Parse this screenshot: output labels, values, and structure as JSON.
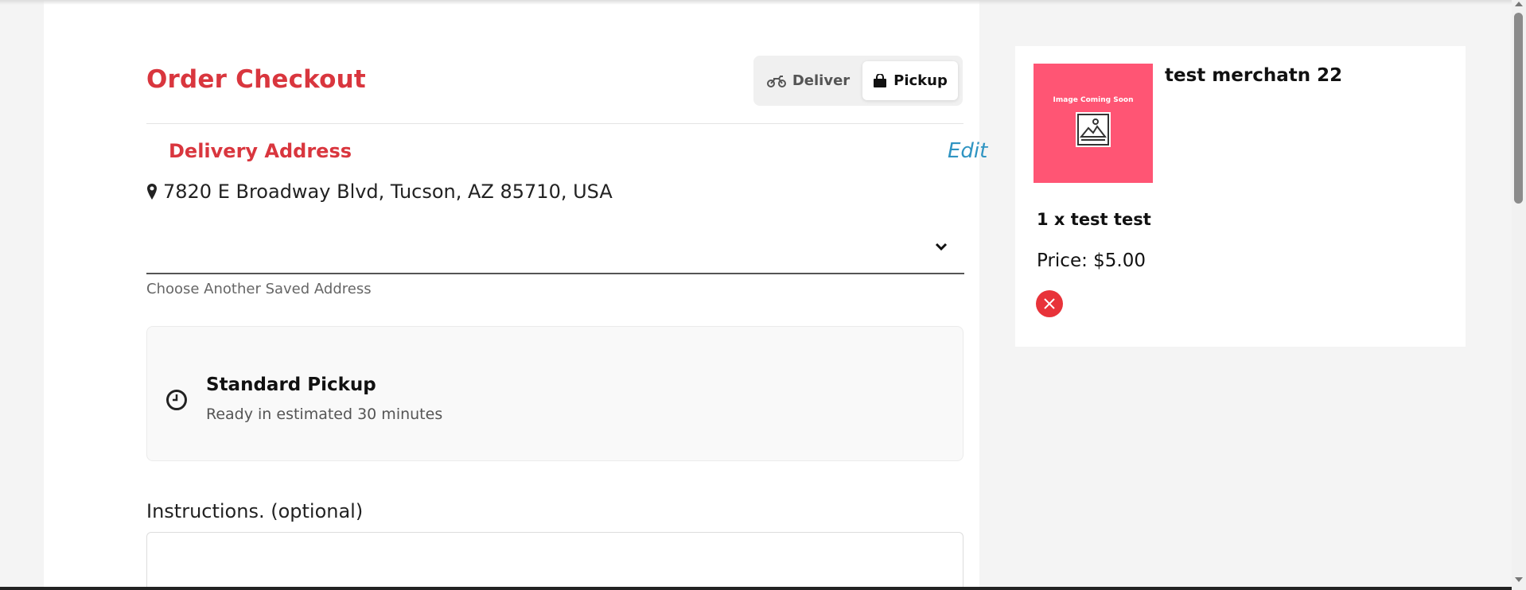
{
  "checkout": {
    "title": "Order Checkout",
    "mode_toggle": {
      "deliver_label": "Deliver",
      "pickup_label": "Pickup",
      "selected": "Pickup"
    },
    "delivery_address": {
      "heading": "Delivery Address",
      "edit_label": "Edit",
      "address": "7820 E Broadway Blvd, Tucson, AZ 85710, USA"
    },
    "saved_address": {
      "value": "",
      "helper": "Choose Another Saved Address"
    },
    "pickup_option": {
      "title": "Standard Pickup",
      "subtitle": "Ready in estimated 30 minutes"
    },
    "instructions": {
      "label": "Instructions. (optional)",
      "value": ""
    }
  },
  "cart": {
    "merchant_name": "test merchatn 22",
    "image_placeholder_text": "Image Coming Soon",
    "items": [
      {
        "quantity_line": "1 x test test",
        "price_line": "Price: $5.00"
      }
    ]
  },
  "icons": {
    "deliver": "motorcycle-icon",
    "pickup": "shopping-bag-icon",
    "address": "map-marker-icon",
    "dropdown": "chevron-down-icon",
    "pickup_time": "clock-icon",
    "remove": "close-icon",
    "image_placeholder": "image-icon"
  },
  "colors": {
    "accent_red": "#d9363e",
    "edit_link": "#2f94c2",
    "placeholder_pink": "#ff5574",
    "remove_red": "#e8333a"
  }
}
